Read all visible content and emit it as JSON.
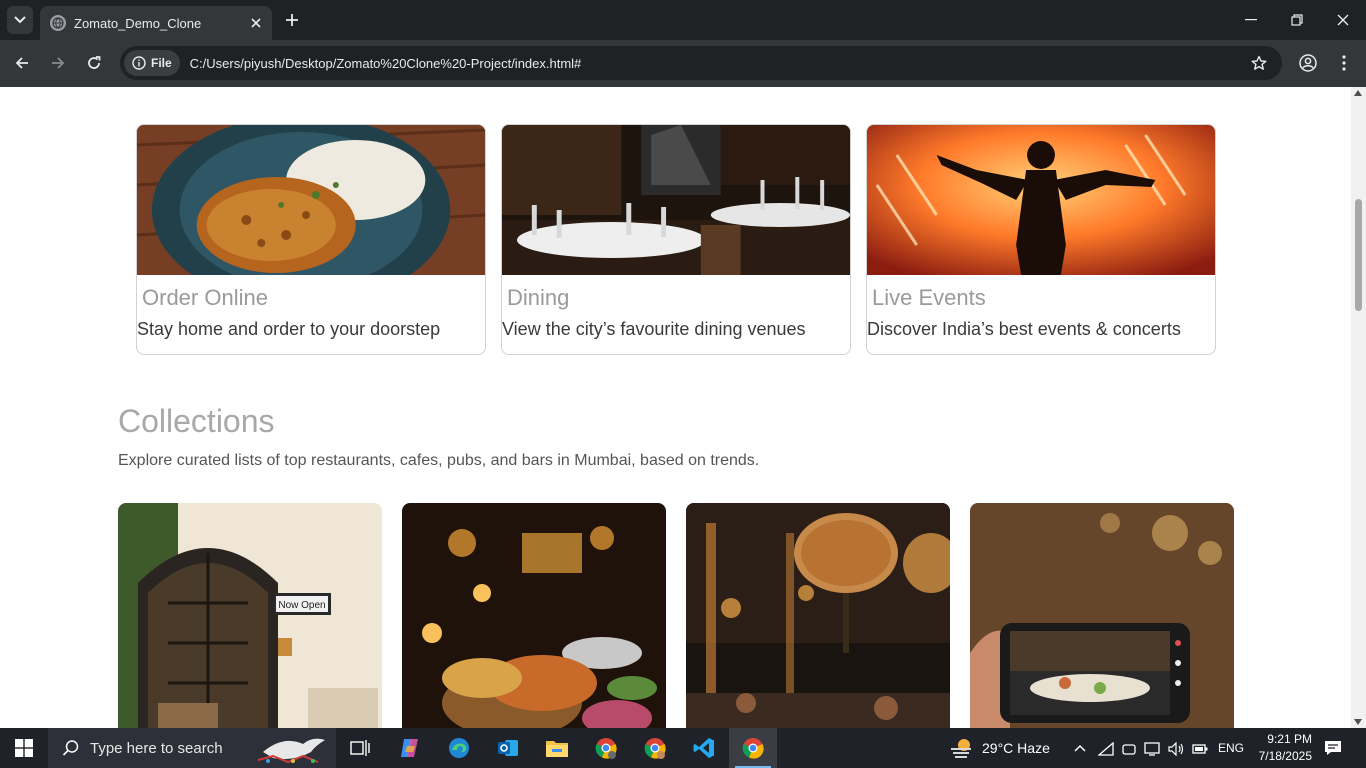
{
  "browser": {
    "tab_title": "Zomato_Demo_Clone",
    "site_chip_label": "File",
    "url": "C:/Users/piyush/Desktop/Zomato%20Clone%20-Project/index.html#"
  },
  "services": [
    {
      "title": "Order Online",
      "subtitle": "Stay home and order to your doorstep",
      "image": "plate-of-chickpea-curry-and-rice"
    },
    {
      "title": "Dining",
      "subtitle": "View the city’s favourite dining venues",
      "image": "restaurant-dining-tables"
    },
    {
      "title": "Live Events",
      "subtitle": "Discover India’s best events & concerts",
      "image": "concert-performer-silhouette"
    }
  ],
  "collections": {
    "title": "Collections",
    "description": "Explore curated lists of top restaurants, cafes, pubs, and bars in Mumbai, based on trends.",
    "cards": [
      {
        "image": "cafe-storefront-with-now-open-sign",
        "sign_text": "Now Open"
      },
      {
        "image": "indian-food-thali-with-candles"
      },
      {
        "image": "bar-interior-with-hanging-lamps"
      },
      {
        "image": "phone-photographing-restaurant-table"
      }
    ]
  },
  "taskbar": {
    "search_placeholder": "Type here to search",
    "weather": "29°C  Haze",
    "language": "ENG",
    "time": "9:21 PM",
    "date": "7/18/2025"
  },
  "colors": {
    "chrome_dark": "#202124",
    "chrome_toolbar": "#35363a",
    "title_gray": "#9a9a9a",
    "taskbar": "#1f2228"
  }
}
